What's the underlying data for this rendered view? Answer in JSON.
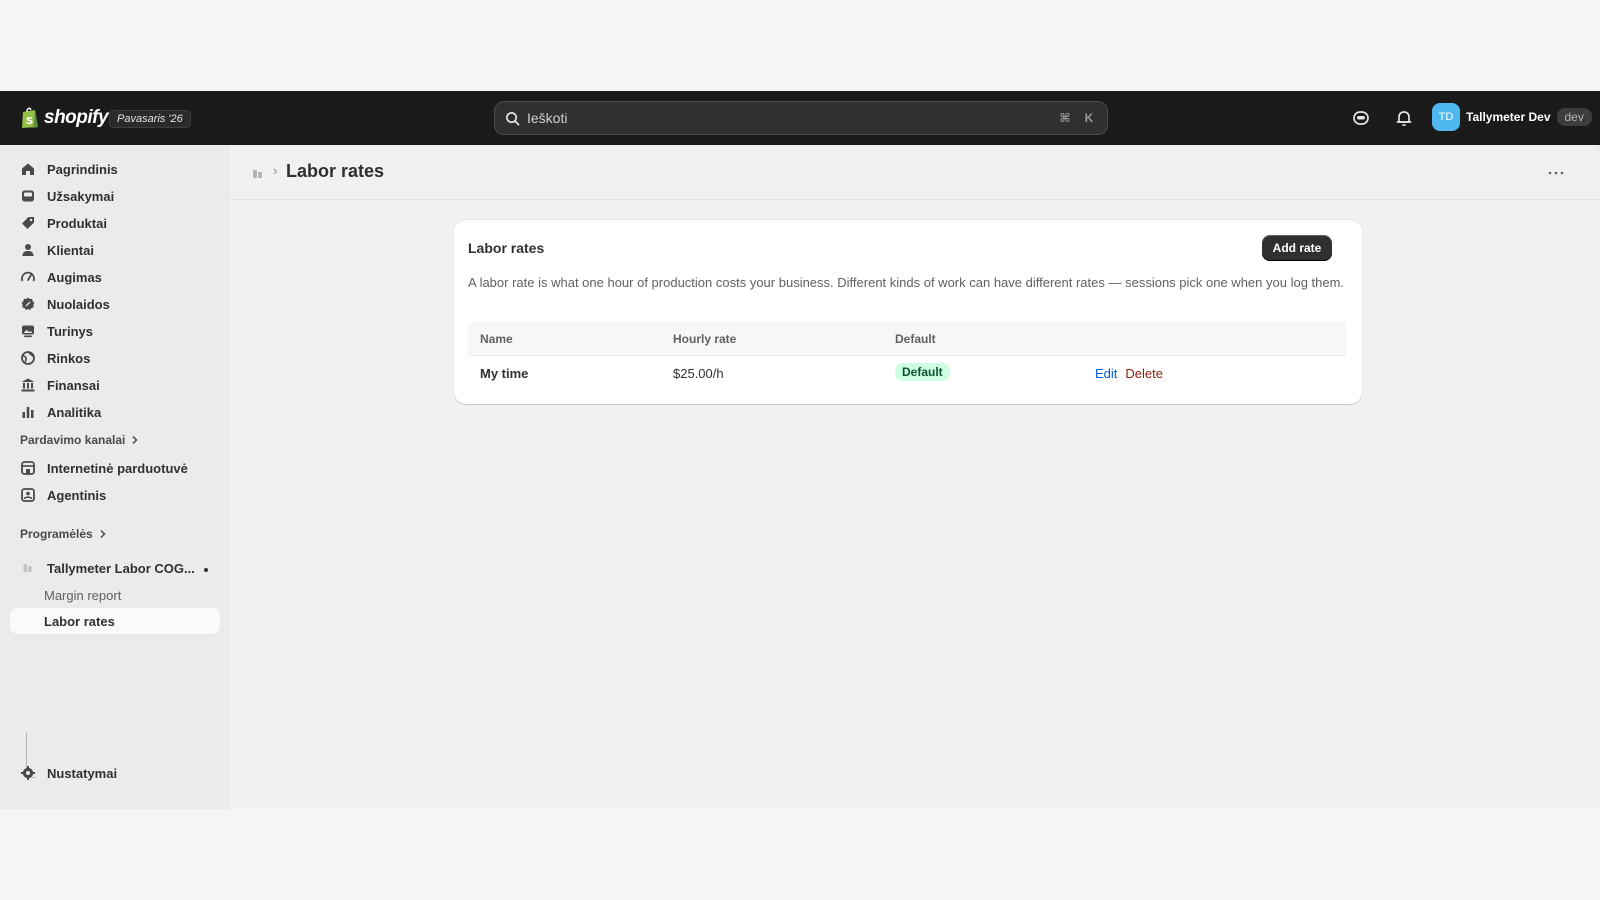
{
  "topbar": {
    "brand": "shopify",
    "release_badge": "Pavasaris '26",
    "search_placeholder": "Ieškoti",
    "shortcut_keys": [
      "⌘",
      "K"
    ],
    "user_initials": "TD",
    "user_name": "Tallymeter Dev",
    "store_tag": "dev"
  },
  "sidebar": {
    "items": [
      {
        "label": "Pagrindinis",
        "icon": "home-icon"
      },
      {
        "label": "Užsakymai",
        "icon": "inbox-icon"
      },
      {
        "label": "Produktai",
        "icon": "tag-icon"
      },
      {
        "label": "Klientai",
        "icon": "person-icon"
      },
      {
        "label": "Augimas",
        "icon": "gauge-icon"
      },
      {
        "label": "Nuolaidos",
        "icon": "discount-icon"
      },
      {
        "label": "Turinys",
        "icon": "content-icon"
      },
      {
        "label": "Rinkos",
        "icon": "globe-icon"
      },
      {
        "label": "Finansai",
        "icon": "bank-icon"
      },
      {
        "label": "Analitika",
        "icon": "chart-bar-icon"
      }
    ],
    "sales_channels_label": "Pardavimo kanalai",
    "sales_channels": [
      {
        "label": "Internetinė parduotuvė",
        "icon": "store-icon"
      },
      {
        "label": "Agentinis",
        "icon": "agent-icon"
      }
    ],
    "apps_label": "Programėlės",
    "app_name": "Tallymeter Labor COG...",
    "app_subitems": [
      "Margin report",
      "Labor rates"
    ],
    "settings_label": "Nustatymai"
  },
  "main": {
    "page_title": "Labor rates",
    "card": {
      "title": "Labor rates",
      "add_button": "Add rate",
      "description": "A labor rate is what one hour of production costs your business. Different kinds of work can have different rates — sessions pick one when you log them.",
      "columns": [
        "Name",
        "Hourly rate",
        "Default"
      ],
      "rows": [
        {
          "name": "My time",
          "rate": "$25.00/h",
          "default_badge": "Default",
          "edit": "Edit",
          "delete": "Delete"
        }
      ]
    }
  },
  "colors": {
    "topbar_bg": "#1a1a1a",
    "badge_bg": "#cdfee1",
    "link_blue": "#005bd3",
    "link_red": "#8e1f0b",
    "avatar_bg": "#4fb8ee"
  }
}
